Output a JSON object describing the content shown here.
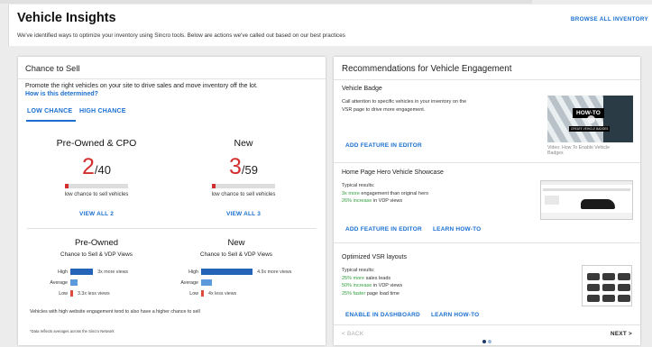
{
  "header": {
    "title": "Vehicle Insights",
    "subtitle": "We've identified ways to optimize your inventory using Sincro tools. Below are actions we've called out based on our best practices",
    "browse_link": "BROWSE ALL INVENTORY"
  },
  "chance": {
    "title": "Chance to Sell",
    "promo": "Promote the right vehicles on your site to drive sales and move inventory off the lot.",
    "how_link": "How is this determined?",
    "tabs": [
      "LOW CHANCE",
      "HIGH CHANCE"
    ],
    "active_tab": "LOW CHANCE",
    "stats": [
      {
        "head": "Pre-Owned & CPO",
        "num": "2",
        "den": "/40",
        "fraction": 0.05,
        "caption": "low chance to sell vehicles",
        "view": "VIEW ALL 2"
      },
      {
        "head": "New",
        "num": "3",
        "den": "/59",
        "fraction": 0.0508,
        "caption": "low chance to sell vehicles",
        "view": "VIEW ALL 3"
      }
    ],
    "vdp": [
      {
        "head": "Pre-Owned",
        "sub": "Chance to Sell & VDP Views",
        "rows": [
          {
            "label": "High",
            "note": "3x more views",
            "level": 0.3,
            "color": "#2563b8"
          },
          {
            "label": "Average",
            "note": "",
            "level": 0.1,
            "color": "#5b9bdc"
          },
          {
            "label": "Low",
            "note": "3.3x less views",
            "level": 0.03,
            "color": "#e04a3a"
          }
        ]
      },
      {
        "head": "New",
        "sub": "Chance to Sell & VDP Views",
        "rows": [
          {
            "label": "High",
            "note": "4.9x more views",
            "level": 0.68,
            "color": "#2563b8"
          },
          {
            "label": "Average",
            "note": "",
            "level": 0.14,
            "color": "#5b9bdc"
          },
          {
            "label": "Low",
            "note": "4x less views",
            "level": 0.03,
            "color": "#e04a3a"
          }
        ]
      }
    ],
    "footnote": "Vehicles with high website engagement tend to also have a higher chance to sell",
    "data_note": "*Data reflects averages across the Sincro Network"
  },
  "recs": {
    "title": "Recommendations for Vehicle Engagement",
    "badge": {
      "title": "Vehicle Badge",
      "body1": "Call attention to specific vehicles in your inventory on the",
      "body2": "VSR page to drive more engagement.",
      "action": "ADD FEATURE IN EDITOR",
      "thumb_text": "HOW-TO",
      "thumb_sub": "CREATE VEHICLE BADGES",
      "caption1": "Video: How To Enable Vehicle",
      "caption2": "Badges"
    },
    "hero": {
      "title": "Home Page Hero Vehicle Showcase",
      "typical": "Typical results:",
      "l1_hi": "3x more",
      "l1_rest": " engagement than original hero",
      "l2_hi": "26% increase",
      "l2_rest": " in VDP views",
      "action1": "ADD FEATURE IN EDITOR",
      "action2": "LEARN HOW-TO"
    },
    "vsr": {
      "title": "Optimized VSR layouts",
      "typical": "Typical results:",
      "l1_hi": "25% more",
      "l1_rest": " sales leads",
      "l2_hi": "50% increase",
      "l2_rest": " in VDP views",
      "l3_hi": "25% faster",
      "l3_rest": " page load time",
      "action1": "ENABLE IN DASHBOARD",
      "action2": "LEARN HOW-TO"
    },
    "nav": {
      "back": "< BACK",
      "next": "NEXT >",
      "page": 1,
      "pages": 2
    }
  },
  "colors": {
    "accent": "#1a6fd0",
    "alert": "#d32f2f",
    "positive": "#2e9e3a"
  }
}
